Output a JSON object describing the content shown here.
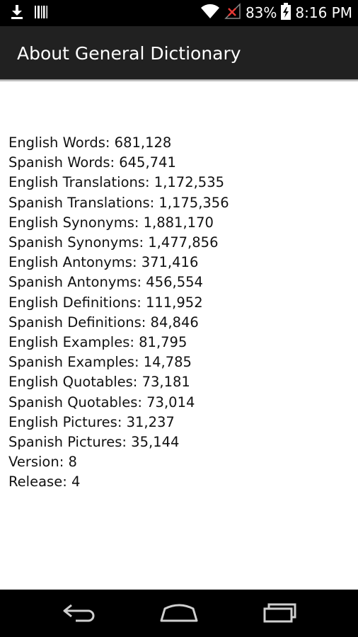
{
  "status_bar": {
    "battery": "83%",
    "time": "8:16 PM",
    "icons": [
      "download-icon",
      "barcode-icon",
      "wifi-icon",
      "signal-off-icon",
      "battery-charging-icon"
    ]
  },
  "action_bar": {
    "title": "About General Dictionary"
  },
  "stats": [
    "English Words: 681,128",
    "Spanish Words: 645,741",
    "English Translations: 1,172,535",
    "Spanish Translations: 1,175,356",
    "English Synonyms: 1,881,170",
    "Spanish Synonyms: 1,477,856",
    "English Antonyms: 371,416",
    "Spanish Antonyms: 456,554",
    "English Definitions: 111,952",
    "Spanish Definitions: 84,846",
    "English Examples: 81,795",
    "Spanish Examples: 14,785",
    "English Quotables: 73,181",
    "Spanish Quotables: 73,014",
    "English Pictures: 31,237",
    "Spanish Pictures: 35,144",
    "Version: 8",
    "Release: 4"
  ],
  "nav_bar": {
    "buttons": [
      "back-icon",
      "home-icon",
      "recents-icon"
    ]
  },
  "colors": {
    "status_bar_bg": "#000000",
    "action_bar_bg": "#212121",
    "content_bg": "#ffffff",
    "text": "#111111"
  }
}
